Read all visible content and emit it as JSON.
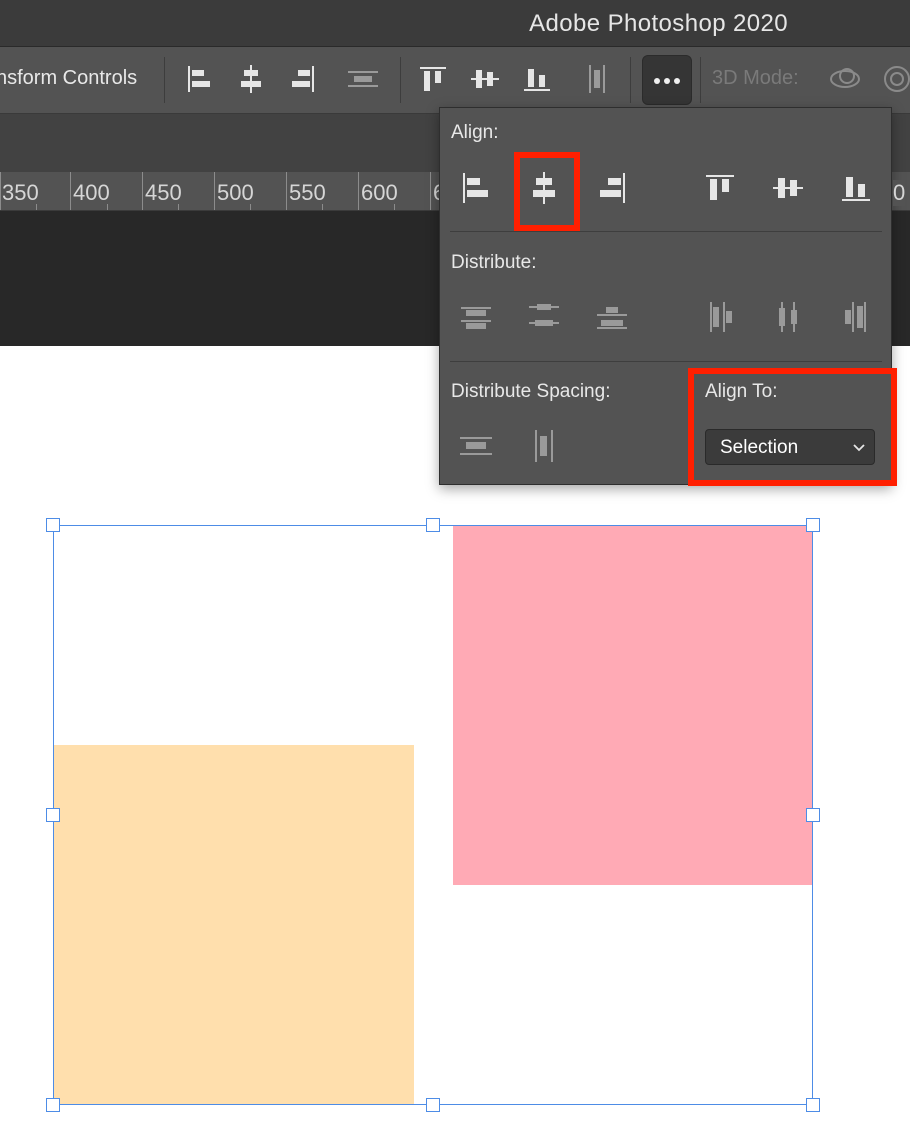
{
  "app": {
    "title": "Adobe Photoshop 2020"
  },
  "options_bar": {
    "transform_label": "nsform Controls",
    "mode_3d_label": "3D Mode:",
    "icons": [
      "align-left-edges-icon",
      "align-horizontal-centers-icon",
      "align-right-edges-icon",
      "distribute-vertical-spacing-icon",
      "align-top-edges-icon",
      "align-vertical-centers-icon",
      "align-bottom-edges-icon",
      "distribute-horizontal-spacing-icon",
      "more-options-icon",
      "orbit-3d-icon",
      "rotate-3d-icon"
    ]
  },
  "ruler": {
    "labels": [
      "350",
      "400",
      "450",
      "500",
      "550",
      "600",
      "6"
    ]
  },
  "align_popover": {
    "align_label": "Align:",
    "distribute_label": "Distribute:",
    "distribute_spacing_label": "Distribute Spacing:",
    "align_to_label": "Align To:",
    "align_to_value": "Selection",
    "ruler_edge_label": "0"
  },
  "colors": {
    "highlight": "#ff1f00",
    "selection_border": "#4d8ce6",
    "pink_layer": "#ffaab5",
    "peach_layer": "#ffdfad"
  }
}
